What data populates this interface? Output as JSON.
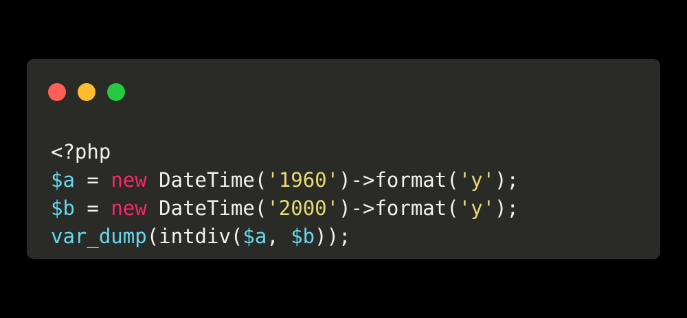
{
  "colors": {
    "background": "#000000",
    "window": "#2a2a26",
    "plain": "#f2f2ec",
    "variable": "#66d9ef",
    "keyword": "#f92672",
    "string": "#e6db74",
    "close": "#ff5f57",
    "minimize": "#febc2e",
    "maximize": "#28c840"
  },
  "window_controls": {
    "close": "close-dot-icon",
    "minimize": "minimize-dot-icon",
    "maximize": "maximize-dot-icon"
  },
  "code": {
    "lines": [
      [
        {
          "t": "plain",
          "v": "<?php"
        }
      ],
      [
        {
          "t": "variable",
          "v": "$a"
        },
        {
          "t": "plain",
          "v": " = "
        },
        {
          "t": "keyword",
          "v": "new"
        },
        {
          "t": "plain",
          "v": " DateTime("
        },
        {
          "t": "string",
          "v": "'1960'"
        },
        {
          "t": "plain",
          "v": ")->format("
        },
        {
          "t": "string",
          "v": "'y'"
        },
        {
          "t": "plain",
          "v": ");"
        }
      ],
      [
        {
          "t": "variable",
          "v": "$b"
        },
        {
          "t": "plain",
          "v": " = "
        },
        {
          "t": "keyword",
          "v": "new"
        },
        {
          "t": "plain",
          "v": " DateTime("
        },
        {
          "t": "string",
          "v": "'2000'"
        },
        {
          "t": "plain",
          "v": ")->format("
        },
        {
          "t": "string",
          "v": "'y'"
        },
        {
          "t": "plain",
          "v": ");"
        }
      ],
      [
        {
          "t": "variable",
          "v": "var_dump"
        },
        {
          "t": "plain",
          "v": "(intdiv("
        },
        {
          "t": "variable",
          "v": "$a"
        },
        {
          "t": "plain",
          "v": ", "
        },
        {
          "t": "variable",
          "v": "$b"
        },
        {
          "t": "plain",
          "v": "));"
        }
      ]
    ]
  }
}
